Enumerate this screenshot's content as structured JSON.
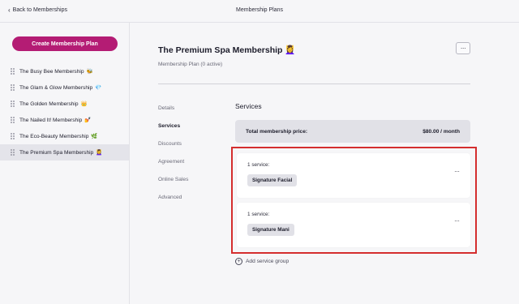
{
  "topbar": {
    "back_label": "Back to Memberships",
    "title": "Membership Plans"
  },
  "sidebar": {
    "create_label": "Create Membership Plan",
    "items": [
      {
        "label": "The Busy Bee Membership",
        "emoji": "🐝"
      },
      {
        "label": "The Glam & Glow Membership",
        "emoji": "💎"
      },
      {
        "label": "The Golden Membership",
        "emoji": "👑"
      },
      {
        "label": "The Nailed It! Membership",
        "emoji": "💅"
      },
      {
        "label": "The Eco-Beauty Membership",
        "emoji": "🌿"
      },
      {
        "label": "The Premium Spa Membership",
        "emoji": "💆‍♀️"
      }
    ],
    "active_index": 5
  },
  "plan": {
    "title": "The Premium Spa Membership",
    "emoji": "💆‍♀️",
    "subtitle": "Membership Plan (0 active)",
    "more_label": "···"
  },
  "tabs": [
    "Details",
    "Services",
    "Discounts",
    "Agreement",
    "Online Sales",
    "Advanced"
  ],
  "active_tab": "Services",
  "services": {
    "title": "Services",
    "total_label": "Total membership price:",
    "total_value": "$80.00 / month",
    "groups": [
      {
        "count_label": "1 service:",
        "service": "Signature Facial",
        "more": "···"
      },
      {
        "count_label": "1 service:",
        "service": "Signature Mani",
        "more": "···"
      }
    ],
    "add_group_label": "Add service group"
  },
  "colors": {
    "accent": "#b41c74",
    "highlight_border": "#d42e2e"
  }
}
